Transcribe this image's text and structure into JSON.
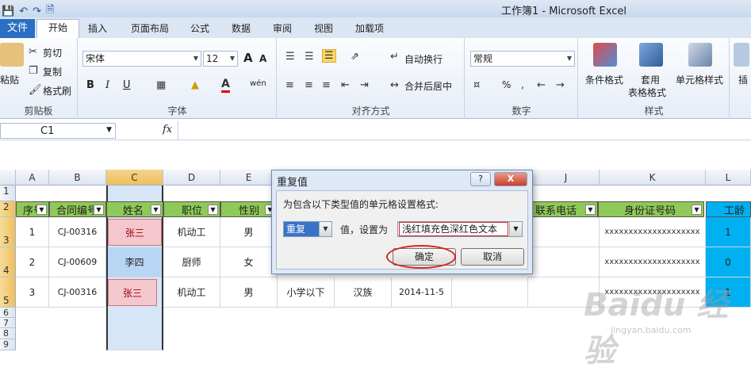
{
  "window": {
    "title": "工作簿1 - Microsoft Excel",
    "qat_icons": [
      "save-icon",
      "undo-icon",
      "redo-icon",
      "print-preview-icon"
    ]
  },
  "tabs": {
    "file": "文件",
    "items": [
      "开始",
      "插入",
      "页面布局",
      "公式",
      "数据",
      "审阅",
      "视图",
      "加载项"
    ],
    "active": "开始"
  },
  "ribbon": {
    "clipboard": {
      "paste": "粘贴",
      "cut": "剪切",
      "copy": "复制",
      "format_painter": "格式刷",
      "label": "剪贴板"
    },
    "font": {
      "name": "宋体",
      "size": "12",
      "label": "字体",
      "bold": "B",
      "italic": "I",
      "underline": "U",
      "grow": "A",
      "shrink": "A",
      "font_color": "A",
      "phonetic": "wén"
    },
    "alignment": {
      "wrap": "自动换行",
      "merge": "合并后居中",
      "label": "对齐方式"
    },
    "number": {
      "format": "常规",
      "percent": "%",
      "comma": ",",
      "label": "数字"
    },
    "styles": {
      "conditional": "条件格式",
      "table_line1": "套用",
      "table_line2": "表格格式",
      "cell_styles": "单元格样式",
      "label": "样式"
    },
    "cells": {
      "insert": "插"
    }
  },
  "formula_bar": {
    "name_box": "C1",
    "fx": "fx",
    "formula": ""
  },
  "grid": {
    "columns": [
      "A",
      "B",
      "C",
      "D",
      "E",
      "F",
      "G",
      "H",
      "I",
      "J",
      "K",
      "L"
    ],
    "rows": [
      "1",
      "2",
      "3",
      "4",
      "5",
      "6",
      "7",
      "8",
      "9"
    ],
    "headers": {
      "A": "序号",
      "B": "合同编号",
      "C": "姓名",
      "D": "职位",
      "E": "性别",
      "J": "联系电话",
      "K": "身份证号码",
      "L": "工龄"
    },
    "data": [
      {
        "A": "1",
        "B": "CJ-00316",
        "C": "张三",
        "D": "机动工",
        "E": "男",
        "K": "xxxxxxxxxxxxxxxxxxxx",
        "L": "1"
      },
      {
        "A": "2",
        "B": "CJ-00609",
        "C": "李四",
        "D": "厨师",
        "E": "女",
        "K": "xxxxxxxxxxxxxxxxxxxx",
        "L": "0"
      },
      {
        "A": "3",
        "B": "CJ-00316",
        "C": "张三",
        "D": "机动工",
        "E": "男",
        "F": "小学以下",
        "G": "汉族",
        "H": "2014-11-5",
        "K": "xxxxxxxxxxxxxxxxxxxx",
        "L": "1"
      }
    ]
  },
  "dialog": {
    "title": "重复值",
    "help": "?",
    "close": "X",
    "prompt": "为包含以下类型值的单元格设置格式:",
    "type_value": "重复",
    "label_value": "值，设置为",
    "format_value": "浅红填充色深红色文本",
    "ok": "确定",
    "cancel": "取消"
  },
  "watermark": {
    "brand": "Baidu 经验",
    "url": "jingyan.baidu.com"
  },
  "colors": {
    "header_green": "#8fc957",
    "dup_fill": "#f4c7ce",
    "dup_text": "#9c0006",
    "accent_blue": "#2b6fc2",
    "annotation_red": "#d9251d"
  }
}
